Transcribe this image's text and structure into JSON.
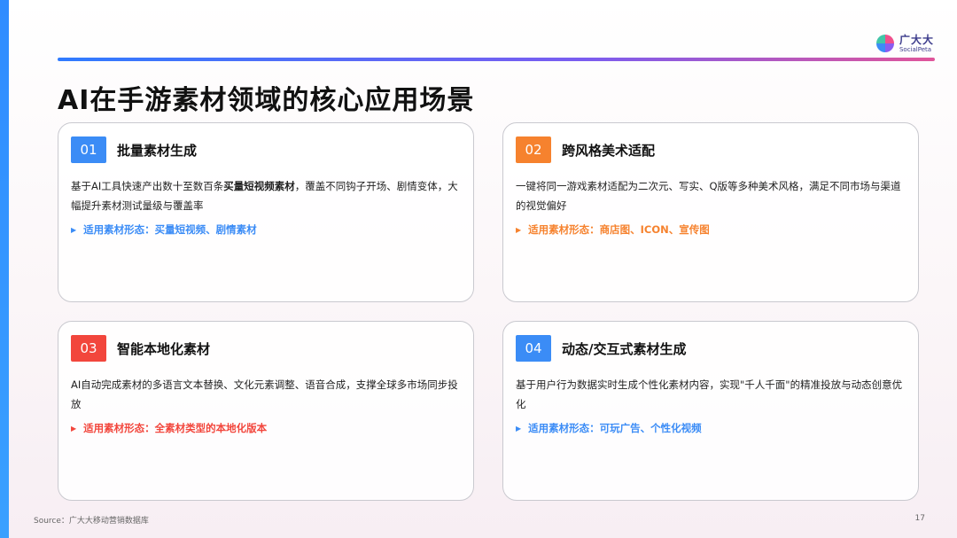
{
  "logo": {
    "cn": "广大大",
    "en": "SocialPeta"
  },
  "title": "AI在手游素材领域的核心应用场景",
  "cards": [
    {
      "number": "01",
      "title": "批量素材生成",
      "desc_before": "基于AI工具快速产出数十至数百条",
      "desc_bold": "买量短视频素材",
      "desc_after": "，覆盖不同钩子开场、剧情变体，大幅提升素材测试量级与覆盖率",
      "use": "适用素材形态：买量短视频、剧情素材",
      "badge_color": "#3b8cf6",
      "use_color": "#3b8cf6"
    },
    {
      "number": "02",
      "title": "跨风格美术适配",
      "desc": "一键将同一游戏素材适配为二次元、写实、Q版等多种美术风格，满足不同市场与渠道的视觉偏好",
      "use": "适用素材形态：商店图、ICON、宣传图",
      "badge_color": "#f6822e",
      "use_color": "#f6822e"
    },
    {
      "number": "03",
      "title": "智能本地化素材",
      "desc": "AI自动完成素材的多语言文本替换、文化元素调整、语音合成，支撑全球多市场同步投放",
      "use": "适用素材形态：全素材类型的本地化版本",
      "badge_color": "#f2463c",
      "use_color": "#f2463c"
    },
    {
      "number": "04",
      "title": "动态/交互式素材生成",
      "desc": "基于用户行为数据实时生成个性化素材内容，实现\"千人千面\"的精准投放与动态创意优化",
      "use": "适用素材形态：可玩广告、个性化视频",
      "badge_color": "#3b8cf6",
      "use_color": "#3b8cf6"
    }
  ],
  "footer": {
    "source": "Source：广大大移动营销数据库",
    "page": "17"
  }
}
